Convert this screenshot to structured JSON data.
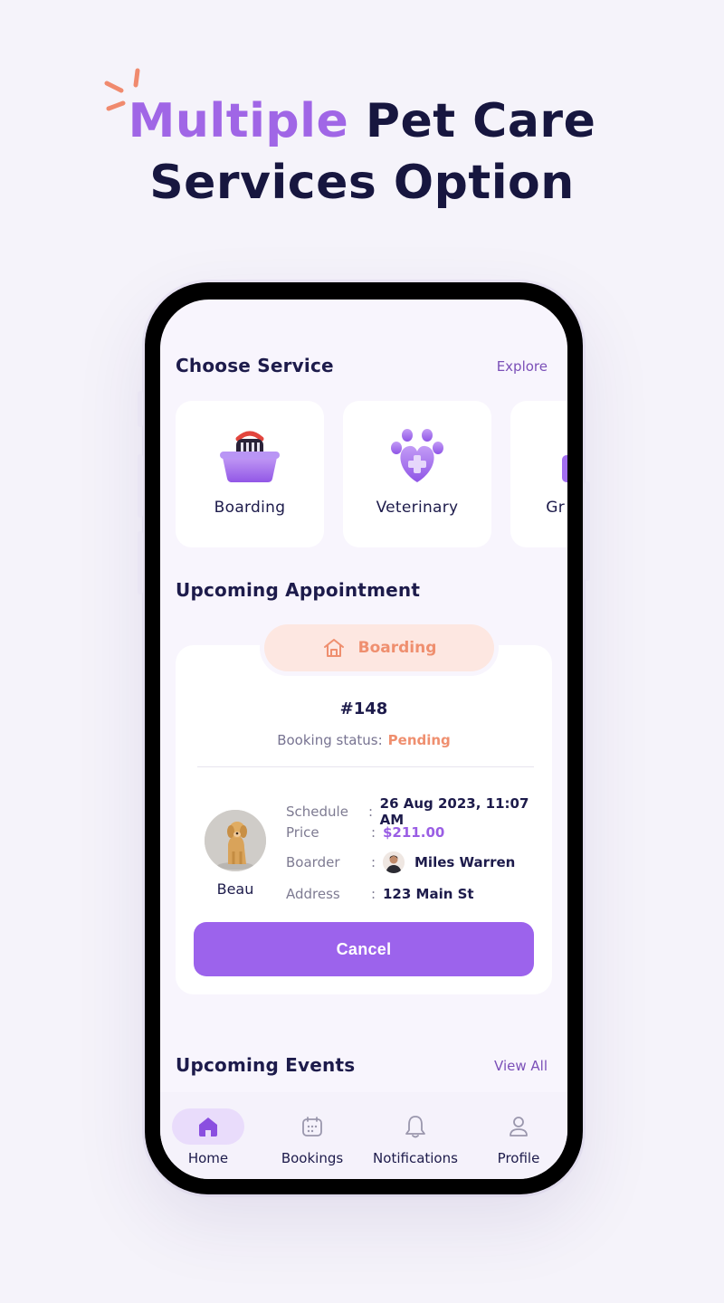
{
  "headline": {
    "accent": "Multiple",
    "rest_line1": "Pet Care",
    "line2": "Services Option"
  },
  "choose_service": {
    "title": "Choose Service",
    "link": "Explore",
    "services": [
      {
        "label": "Boarding",
        "icon": "pet-carrier-icon"
      },
      {
        "label": "Veterinary",
        "icon": "paw-heart-icon"
      },
      {
        "label": "Gr",
        "icon": "grooming-icon"
      }
    ]
  },
  "upcoming_appointment": {
    "title": "Upcoming Appointment",
    "service_label": "Boarding",
    "booking_id": "#148",
    "status_label": "Booking status:",
    "status_value": "Pending",
    "pet_name": "Beau",
    "details": [
      {
        "key": "Schedule",
        "sep": ":",
        "value": "26 Aug 2023, 11:07 AM"
      },
      {
        "key": "Price",
        "sep": ":",
        "value": "$211.00"
      },
      {
        "key": "Boarder",
        "sep": ":",
        "value": "Miles Warren"
      },
      {
        "key": "Address",
        "sep": ":",
        "value": "123 Main St"
      }
    ],
    "cancel_label": "Cancel"
  },
  "upcoming_events": {
    "title": "Upcoming Events",
    "link": "View All"
  },
  "tabbar": {
    "items": [
      {
        "label": "Home",
        "icon": "home-icon",
        "active": true
      },
      {
        "label": "Bookings",
        "icon": "calendar-icon",
        "active": false
      },
      {
        "label": "Notifications",
        "icon": "bell-icon",
        "active": false
      },
      {
        "label": "Profile",
        "icon": "user-icon",
        "active": false
      }
    ]
  },
  "colors": {
    "accent": "#a066e6",
    "button": "#9c63ec",
    "status": "#ef8f6f",
    "ink": "#17163f"
  }
}
